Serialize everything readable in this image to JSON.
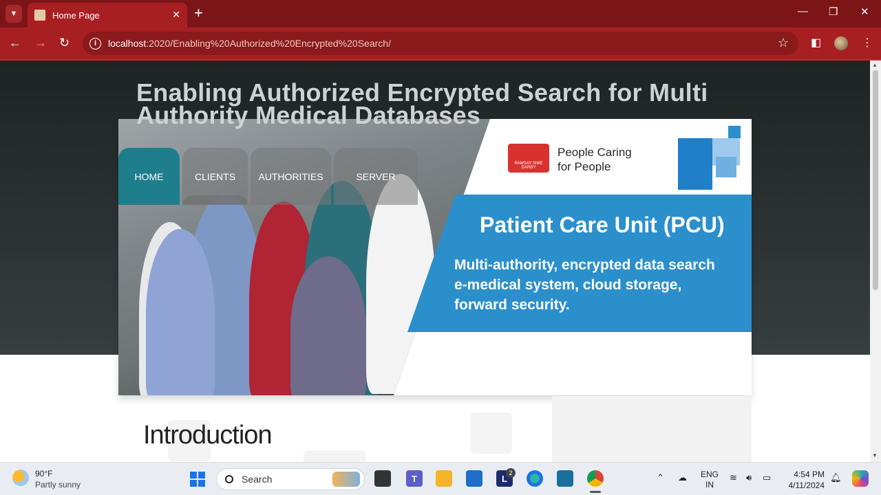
{
  "browser": {
    "tab_title": "Home Page",
    "tab_close": "✕",
    "new_tab": "+",
    "url_host": "localhost",
    "url_path": ":2020/Enabling%20Authorized%20Encrypted%20Search/",
    "window_controls": {
      "minimize": "—",
      "restore": "❐",
      "close": "✕"
    }
  },
  "page": {
    "title": "Enabling Authorized Encrypted Search for Multi Authority Medical Databases",
    "nav": [
      "HOME",
      "CLIENTS",
      "AUTHORITIES",
      "SERVER"
    ],
    "banner": {
      "logo_text": "RAMSAY SIME DARBY",
      "tagline_line1": "People Caring",
      "tagline_line2": "for People",
      "heading": "Patient Care Unit (PCU)",
      "desc_line1": "Multi-authority, encrypted data search",
      "desc_line2": "e-medical system, cloud storage,",
      "desc_line3": "forward security."
    },
    "section_heading": "Introduction"
  },
  "taskbar": {
    "temperature": "90°F",
    "condition": "Partly sunny",
    "search_placeholder": "Search",
    "lang_line1": "ENG",
    "lang_line2": "IN",
    "time": "4:54 PM",
    "date": "4/11/2024",
    "notification_badge": "2"
  },
  "colors": {
    "browser_frame": "#7c1517",
    "toolbar": "#a81f22",
    "nav_active": "#1f7e8c",
    "banner_blue": "#2b8fcb"
  }
}
